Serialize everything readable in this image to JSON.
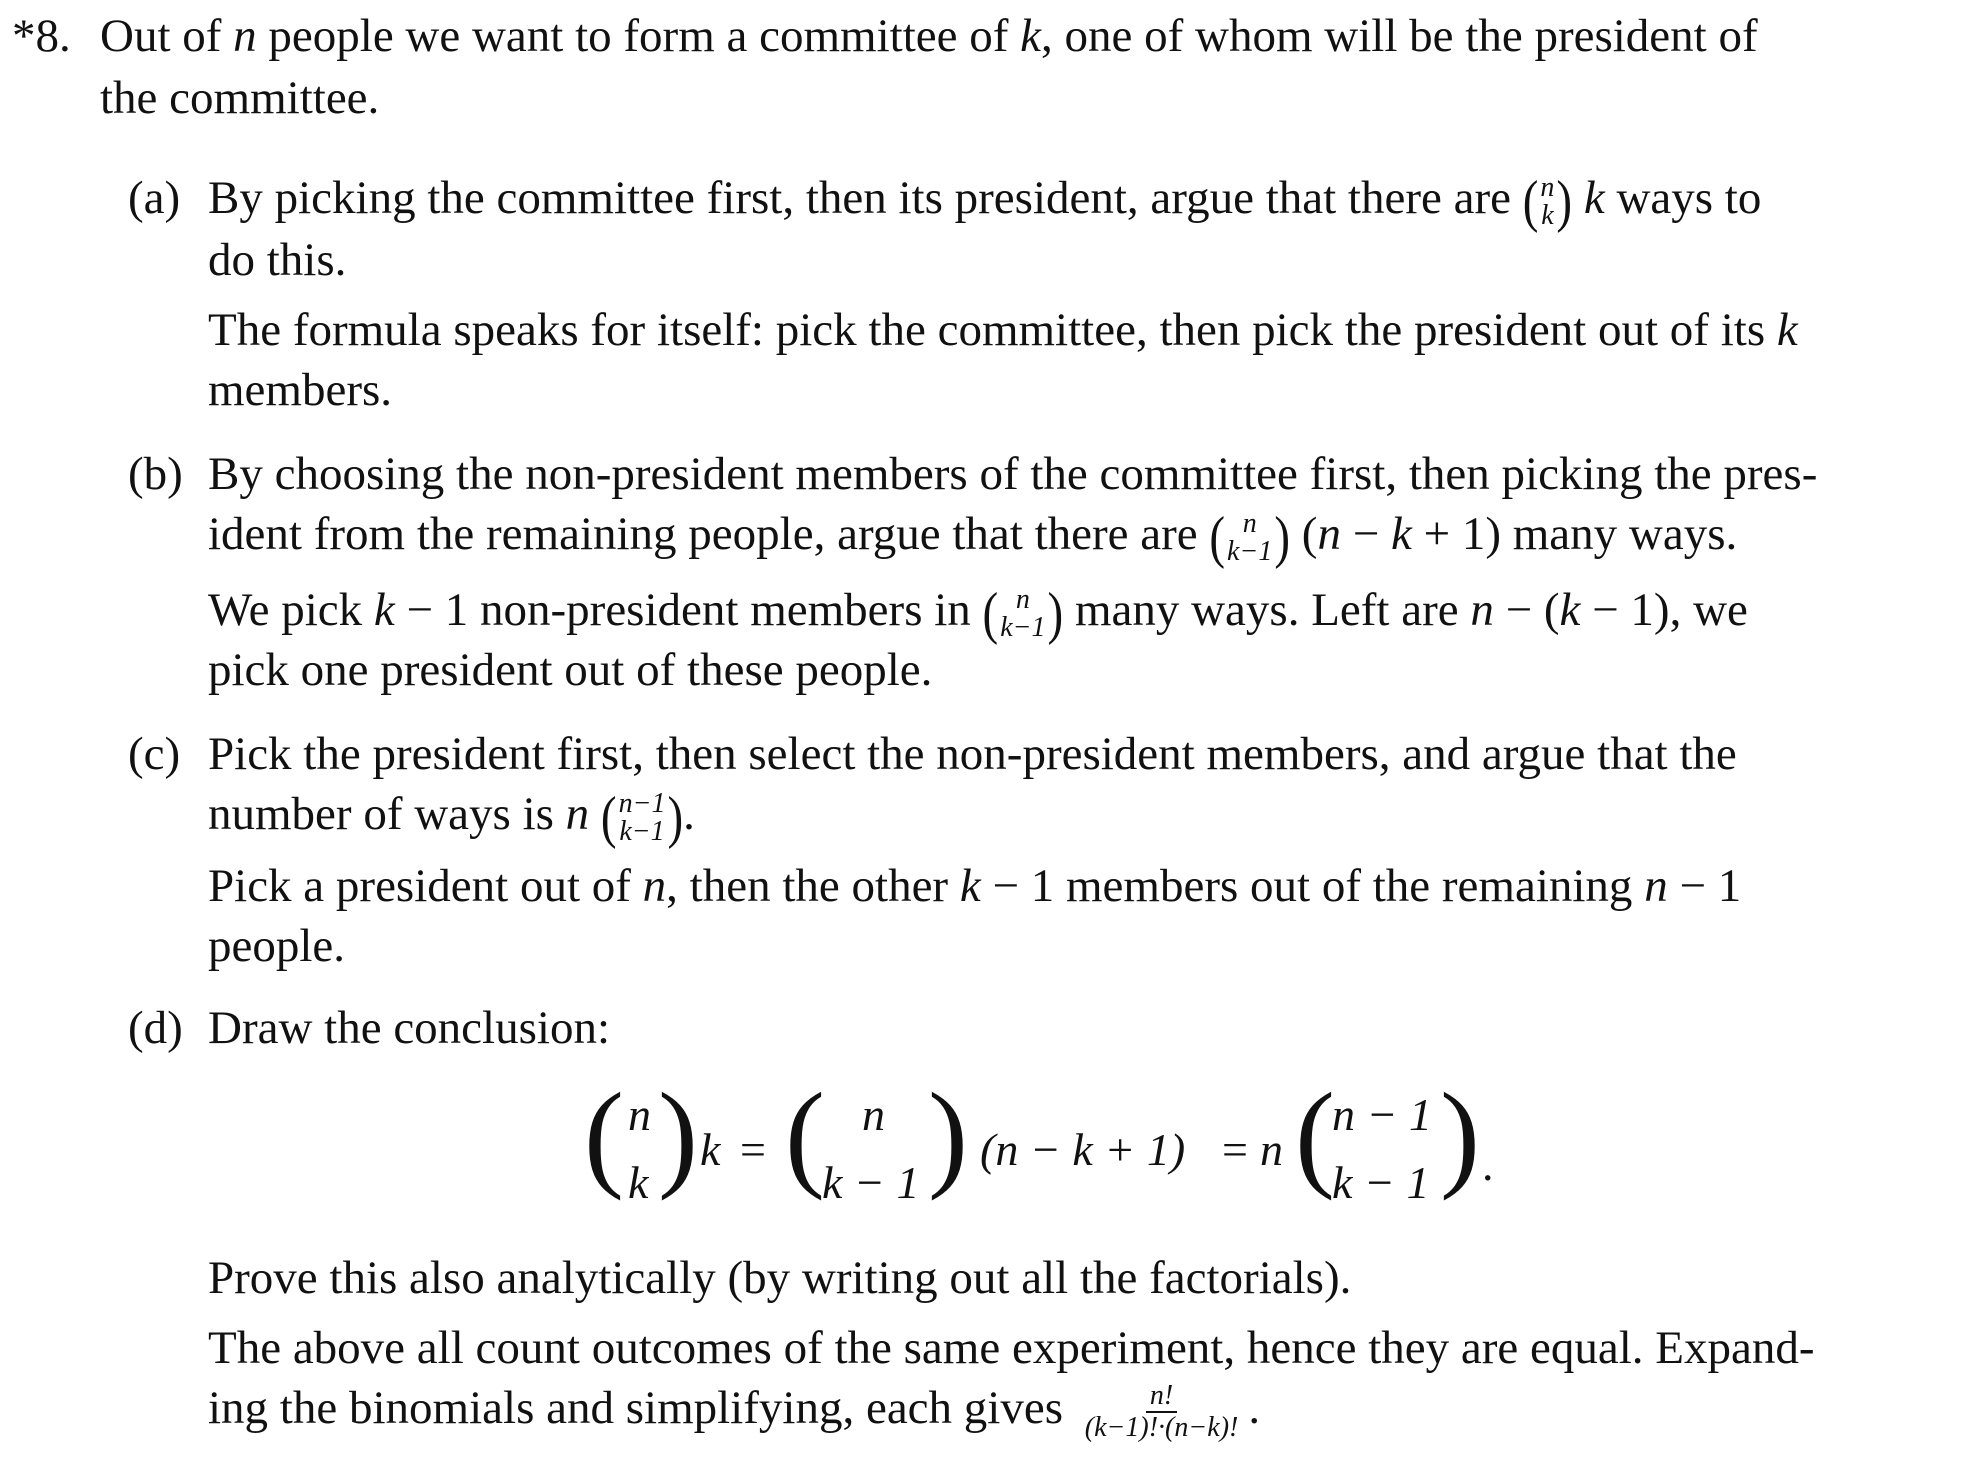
{
  "problem": {
    "number": "*8.",
    "line1": "Out of n people we want to form a committee of k, one of whom will be the president of",
    "line2": "the committee."
  },
  "parts": [
    {
      "label": "(a)",
      "q1": "By picking the committee first, then its president, argue that there are",
      "q1_tail": "k ways to",
      "q2": "do this.",
      "a1": "The formula speaks for itself: pick the committee, then pick the president out of its k",
      "a2": "members."
    },
    {
      "label": "(b)",
      "q1": "By choosing the non-president members of the committee first, then picking the pres-",
      "q2": "ident from the remaining people, argue that there are",
      "q2_tail": "(n − k + 1) many ways.",
      "a1_head": "We pick k − 1 non-president members in",
      "a1_tail": "many ways. Left are n − (k − 1), we",
      "a2": "pick one president out of these people."
    },
    {
      "label": "(c)",
      "q1": "Pick the president first, then select the non-president members, and argue that the",
      "q2": "number of ways is n",
      "a1": "Pick a president out of n, then the other k − 1 members out of the remaining n − 1",
      "a2": "people."
    },
    {
      "label": "(d)",
      "q1": "Draw the conclusion:",
      "prove": "Prove this also analytically (by writing out all the factorials).",
      "a1": "The above all count outcomes of the same experiment, hence they are equal. Expand-",
      "a2": "ing the binomials and simplifying, each gives",
      "frac_num": "n!",
      "frac_den": "(k−1)!·(n−k)!"
    }
  ],
  "equation": {
    "n": "n",
    "k": "k",
    "k_minus_1": "k − 1",
    "n_minus_1": "n − 1",
    "middle_factor": "(n − k + 1)",
    "eq": "=",
    "period": "."
  }
}
